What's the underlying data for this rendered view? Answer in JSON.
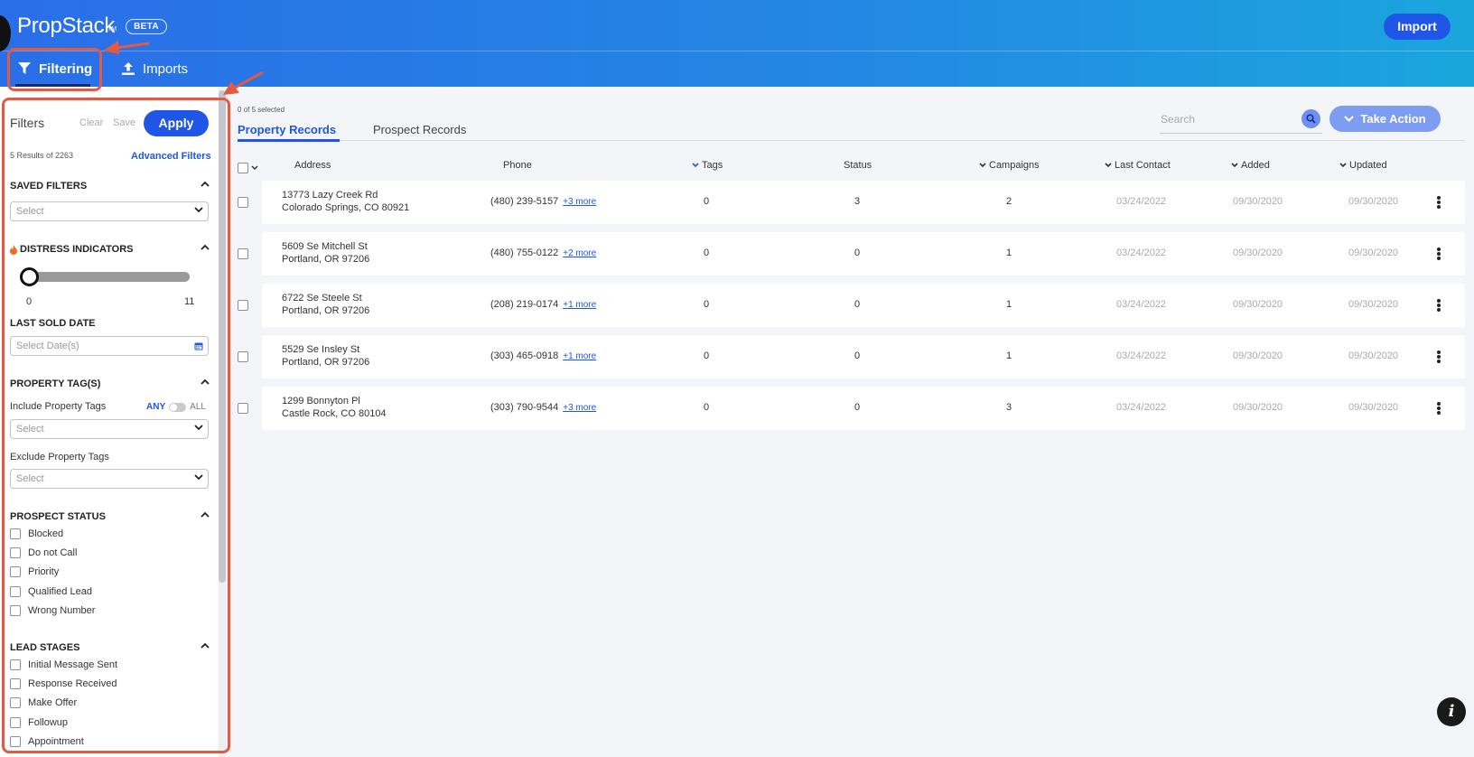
{
  "app": {
    "brand": "PropStack",
    "brand_mark": "TM",
    "beta_badge": "BETA",
    "import_button": "Import"
  },
  "nav": {
    "tabs": [
      {
        "label": "Filtering",
        "icon": "filter-icon",
        "active": true
      },
      {
        "label": "Imports",
        "icon": "upload-icon",
        "active": false
      }
    ]
  },
  "sidebar": {
    "title": "Filters",
    "clear": "Clear",
    "save": "Save",
    "apply": "Apply",
    "results": "5 Results of 2263",
    "advanced": "Advanced Filters",
    "saved_filters": {
      "title": "SAVED FILTERS",
      "placeholder": "Select"
    },
    "distress": {
      "title": "DISTRESS INDICATORS",
      "icon": "fire-icon",
      "min": "0",
      "max": "11",
      "value": 0
    },
    "last_sold": {
      "title": "LAST SOLD DATE",
      "placeholder": "Select Date(s)"
    },
    "property_tags": {
      "title": "PROPERTY TAG(S)",
      "include_label": "Include Property Tags",
      "any": "ANY",
      "all": "ALL",
      "include_placeholder": "Select",
      "exclude_label": "Exclude Property Tags",
      "exclude_placeholder": "Select"
    },
    "prospect_status": {
      "title": "PROSPECT STATUS",
      "options": [
        "Blocked",
        "Do not Call",
        "Priority",
        "Qualified Lead",
        "Wrong Number"
      ]
    },
    "lead_stages": {
      "title": "LEAD STAGES",
      "options": [
        "Initial Message Sent",
        "Response Received",
        "Make Offer",
        "Followup",
        "Appointment"
      ]
    }
  },
  "main": {
    "selected": "0 of 5 selected",
    "tabs": [
      "Property Records",
      "Prospect Records"
    ],
    "search_placeholder": "Search",
    "take_action": "Take Action",
    "columns": [
      "Address",
      "Phone",
      "Tags",
      "Status",
      "Campaigns",
      "Last Contact",
      "Added",
      "Updated"
    ],
    "rows": [
      {
        "address1": "13773 Lazy Creek Rd",
        "address2": "Colorado Springs, CO 80921",
        "phone": "(480) 239-5157",
        "more": "+3 more",
        "tags": "0",
        "status": "3",
        "campaigns": "2",
        "last_contact": "03/24/2022",
        "added": "09/30/2020",
        "updated": "09/30/2020"
      },
      {
        "address1": "5609 Se Mitchell St",
        "address2": "Portland, OR 97206",
        "phone": "(480) 755-0122",
        "more": "+2 more",
        "tags": "0",
        "status": "0",
        "campaigns": "1",
        "last_contact": "03/24/2022",
        "added": "09/30/2020",
        "updated": "09/30/2020"
      },
      {
        "address1": "6722 Se Steele St",
        "address2": "Portland, OR 97206",
        "phone": "(208) 219-0174",
        "more": "+1 more",
        "tags": "0",
        "status": "0",
        "campaigns": "1",
        "last_contact": "03/24/2022",
        "added": "09/30/2020",
        "updated": "09/30/2020"
      },
      {
        "address1": "5529 Se Insley St",
        "address2": "Portland, OR 97206",
        "phone": "(303) 465-0918",
        "more": "+1 more",
        "tags": "0",
        "status": "0",
        "campaigns": "1",
        "last_contact": "03/24/2022",
        "added": "09/30/2020",
        "updated": "09/30/2020"
      },
      {
        "address1": "1299 Bonnyton Pl",
        "address2": "Castle Rock, CO 80104",
        "phone": "(303) 790-9544",
        "more": "+3 more",
        "tags": "0",
        "status": "0",
        "campaigns": "3",
        "last_contact": "03/24/2022",
        "added": "09/30/2020",
        "updated": "09/30/2020"
      }
    ]
  },
  "colors": {
    "primary": "#1f56e8",
    "header_start": "#2a6ee8",
    "header_end": "#1aa6dd",
    "annotation": "#e35a43"
  }
}
